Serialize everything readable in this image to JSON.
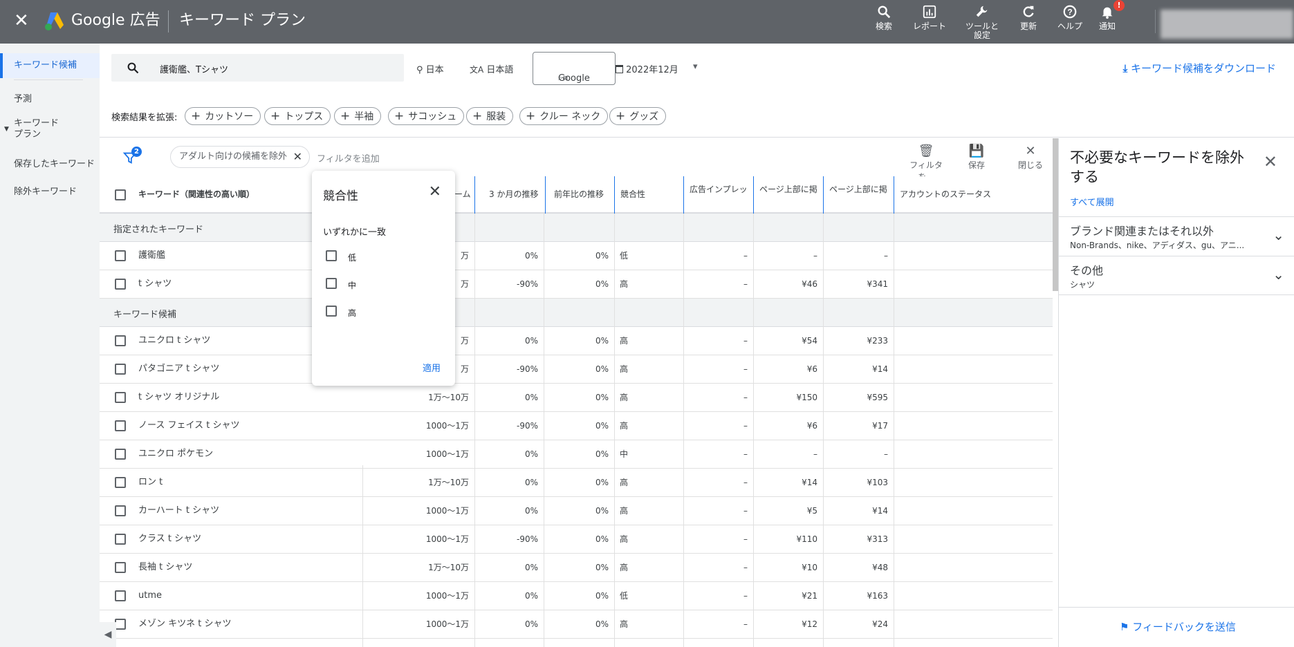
{
  "app": {
    "brand": "Google 広告",
    "page": "キーワード プラン"
  },
  "topnav": [
    {
      "label": "検索",
      "icon": "search-icon"
    },
    {
      "label": "レポート",
      "icon": "report-icon"
    },
    {
      "label": "ツールと 設定",
      "label1": "ツールと",
      "label2": "設定",
      "icon": "wrench-icon"
    },
    {
      "label": "更新",
      "icon": "refresh-icon"
    },
    {
      "label": "ヘルプ",
      "icon": "help-icon"
    },
    {
      "label": "通知",
      "icon": "bell-icon",
      "badge": "!"
    }
  ],
  "sidenav": {
    "items": [
      {
        "label": "キーワード候補"
      },
      {
        "label": "予測"
      },
      {
        "label": "キーワード プラン",
        "line1": "キーワード",
        "line2": "プラン"
      },
      {
        "label": "保存したキーワード"
      },
      {
        "label": "除外キーワード"
      }
    ]
  },
  "query": {
    "search_value": "護衛艦、Tシャツ",
    "location": "日本",
    "language": "日本語",
    "network": "Google",
    "date": "2022年12月",
    "download": "キーワード候補をダウンロード"
  },
  "expand": {
    "label": "検索結果を拡張:",
    "chips": [
      "カットソー",
      "トップス",
      "半袖",
      "サコッシュ",
      "服装",
      "クルー ネック",
      "グッズ"
    ]
  },
  "filters": {
    "count": "2",
    "active_chip": "アダルト向けの候補を除外",
    "add_placeholder": "フィルタを追加",
    "tools": [
      {
        "label": "フィルタを...",
        "icon": "trash-icon"
      },
      {
        "label": "保存",
        "icon": "save-icon"
      },
      {
        "label": "閉じる",
        "icon": "close-icon"
      }
    ]
  },
  "table": {
    "headers": {
      "keyword": "キーワード（関連性の高い順）",
      "volume_tail": "ーム",
      "trend3m": "3 か月の推移",
      "trend_yoy": "前年比の推移",
      "competition": "競合性",
      "impression": "広告インプレッ",
      "top_low": "ページ上部に掲",
      "top_high": "ページ上部に掲",
      "status": "アカウントのステータス"
    },
    "section_specified": "指定されたキーワード",
    "section_ideas": "キーワード候補",
    "specified_rows": [
      {
        "kw": "護衛艦",
        "vol": "万",
        "t3": "0%",
        "yoy": "0%",
        "comp": "低",
        "imp": "–",
        "low": "–",
        "high": "–"
      },
      {
        "kw": "t シャツ",
        "vol": "万",
        "t3": "-90%",
        "yoy": "0%",
        "comp": "高",
        "imp": "–",
        "low": "¥46",
        "high": "¥341"
      }
    ],
    "idea_rows": [
      {
        "kw": "ユニクロ t シャツ",
        "vol": "万",
        "t3": "0%",
        "yoy": "0%",
        "comp": "高",
        "imp": "–",
        "low": "¥54",
        "high": "¥233"
      },
      {
        "kw": "パタゴニア t シャツ",
        "vol": "万",
        "t3": "-90%",
        "yoy": "0%",
        "comp": "高",
        "imp": "–",
        "low": "¥6",
        "high": "¥14"
      },
      {
        "kw": "t シャツ オリジナル",
        "vol": "1万～10万",
        "t3": "0%",
        "yoy": "0%",
        "comp": "高",
        "imp": "–",
        "low": "¥150",
        "high": "¥595"
      },
      {
        "kw": "ノース フェイス t シャツ",
        "vol": "1000～1万",
        "t3": "-90%",
        "yoy": "0%",
        "comp": "高",
        "imp": "–",
        "low": "¥6",
        "high": "¥17"
      },
      {
        "kw": "ユニクロ ポケモン",
        "vol": "1000～1万",
        "t3": "0%",
        "yoy": "0%",
        "comp": "中",
        "imp": "–",
        "low": "–",
        "high": "–"
      },
      {
        "kw": "ロン t",
        "vol": "1万～10万",
        "t3": "0%",
        "yoy": "0%",
        "comp": "高",
        "imp": "–",
        "low": "¥14",
        "high": "¥103"
      },
      {
        "kw": "カーハート t シャツ",
        "vol": "1000～1万",
        "t3": "0%",
        "yoy": "0%",
        "comp": "高",
        "imp": "–",
        "low": "¥5",
        "high": "¥14"
      },
      {
        "kw": "クラス t シャツ",
        "vol": "1000～1万",
        "t3": "-90%",
        "yoy": "0%",
        "comp": "高",
        "imp": "–",
        "low": "¥110",
        "high": "¥313"
      },
      {
        "kw": "長袖 t シャツ",
        "vol": "1万～10万",
        "t3": "0%",
        "yoy": "0%",
        "comp": "高",
        "imp": "–",
        "low": "¥10",
        "high": "¥48"
      },
      {
        "kw": "utme",
        "vol": "1000～1万",
        "t3": "0%",
        "yoy": "0%",
        "comp": "低",
        "imp": "–",
        "low": "¥21",
        "high": "¥163"
      },
      {
        "kw": "メゾン キツネ t シャツ",
        "vol": "1000～1万",
        "t3": "0%",
        "yoy": "0%",
        "comp": "高",
        "imp": "–",
        "low": "¥12",
        "high": "¥24"
      }
    ]
  },
  "competition_popup": {
    "title": "競合性",
    "subtitle": "いずれかに一致",
    "options": [
      "低",
      "中",
      "高"
    ],
    "apply": "適用"
  },
  "right_panel": {
    "title": "不必要なキーワードを除外する",
    "expand_all": "すべて展開",
    "groups": [
      {
        "title": "ブランド関連またはそれ以外",
        "summary": "Non-Brands、nike、アディダス、gu、アニ..."
      },
      {
        "title": "その他",
        "summary": "シャツ"
      }
    ],
    "feedback": "フィードバックを送信"
  },
  "colors": {
    "accent": "#1a73e8",
    "topbar": "#5f6368",
    "badge": "#ea4335"
  }
}
